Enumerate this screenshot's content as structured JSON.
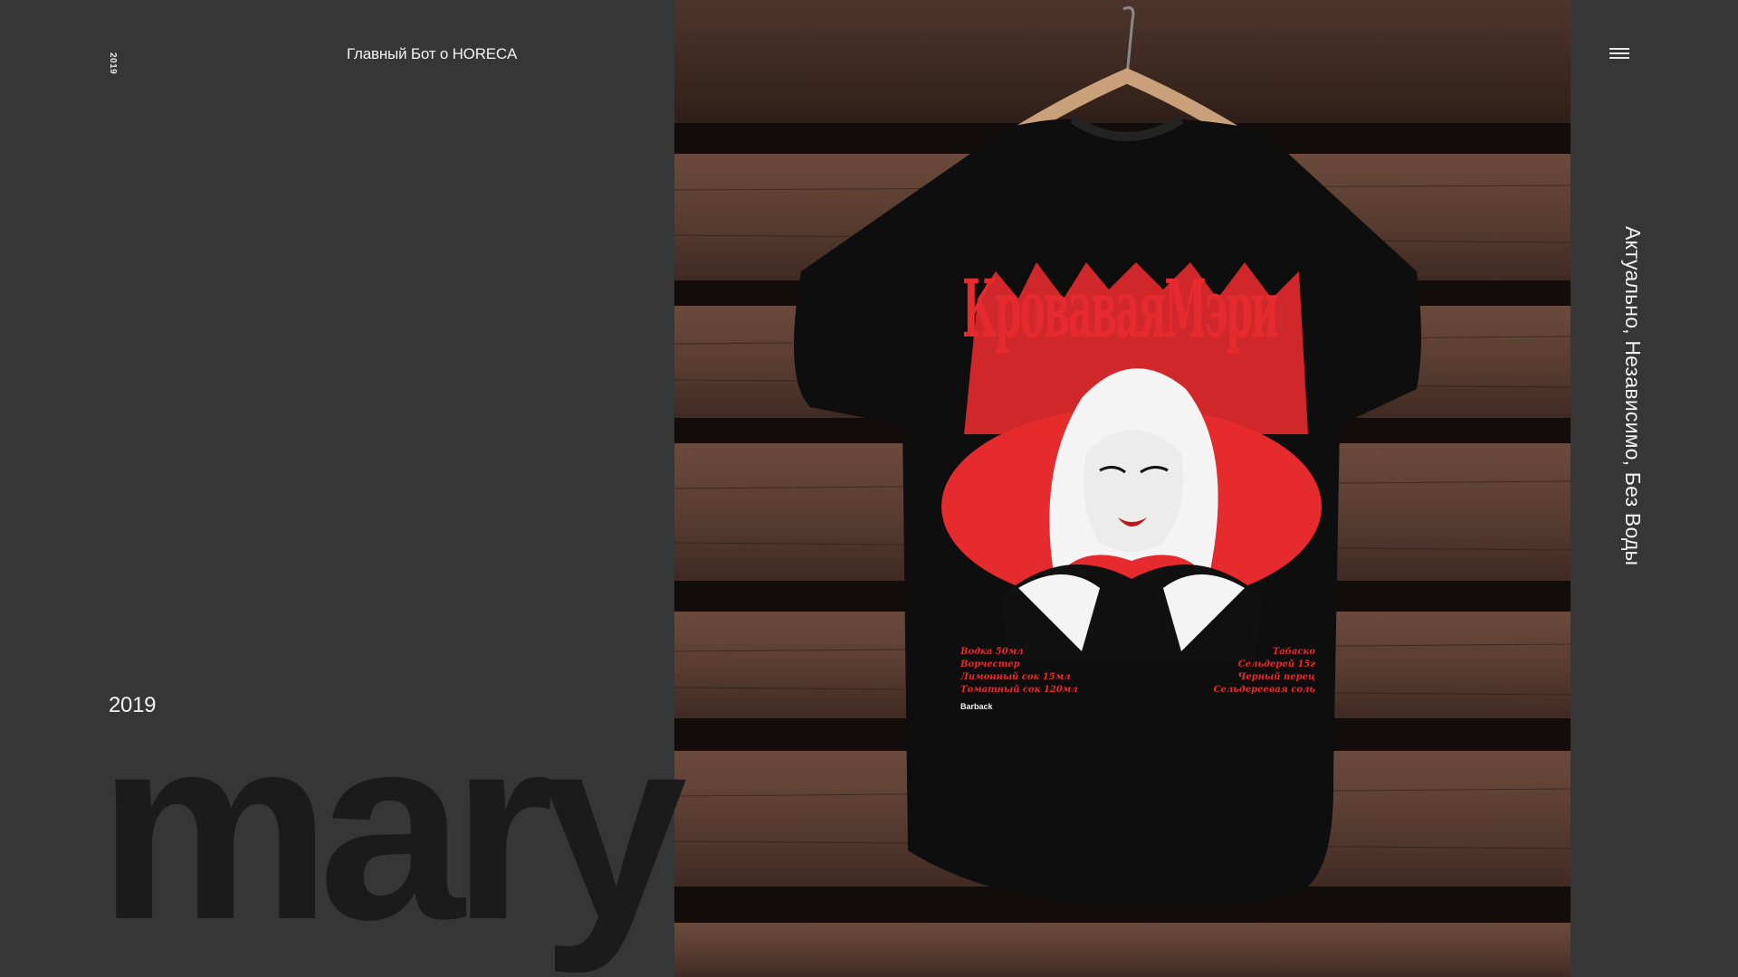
{
  "header": {
    "year_vertical": "2019",
    "site_title": "Главный Бот о HORECA"
  },
  "project": {
    "year": "2019",
    "word": "mary"
  },
  "hero_image": {
    "alt_subject": "t-shirt-on-hanger",
    "print": {
      "title": "КроваваяМэри",
      "recipe_left": [
        "Водка 50мл",
        "Ворчестер",
        "Лимонный сок 15мл",
        "Томатный сок 120мл"
      ],
      "recipe_right": [
        "Табаско",
        "Сельдерей 15г",
        "Черный перец",
        "Сельдереевая соль"
      ],
      "brand": "Barback"
    }
  },
  "sidebar": {
    "menu_icon": "hamburger-menu-icon",
    "tagline": "Актуально, Независимо, Без Воды"
  },
  "colors": {
    "background": "#363636",
    "big_word": "#1b1b1b",
    "print_red": "#e52b2e",
    "text": "#f2f2f2"
  }
}
